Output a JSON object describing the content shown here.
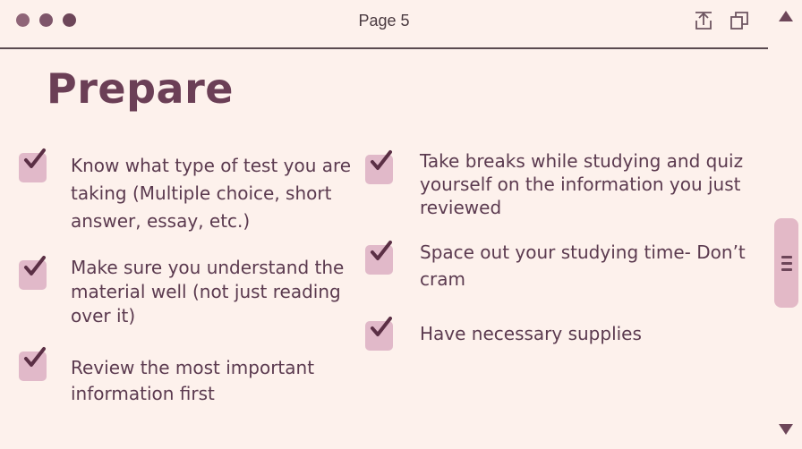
{
  "window": {
    "page_label": "Page 5"
  },
  "heading": "Prepare",
  "left_items": [
    "Know what type of test you are taking (Multiple choice, short answer, essay, etc.)",
    "Make sure you understand the material well (not just reading over it)",
    "Review the most important information first"
  ],
  "right_items": [
    "Take breaks while studying and quiz yourself on the information you just reviewed",
    "Space out your studying time- Don’t cram",
    "Have necessary supplies"
  ],
  "colors": {
    "accent": "#6b3f56",
    "checkbox": "#e1b9c9",
    "background": "#fdf1ec"
  },
  "icons": [
    "share-icon",
    "copy-icon",
    "checkmark-icon",
    "scroll-up-icon",
    "scroll-down-icon",
    "grip-icon"
  ]
}
